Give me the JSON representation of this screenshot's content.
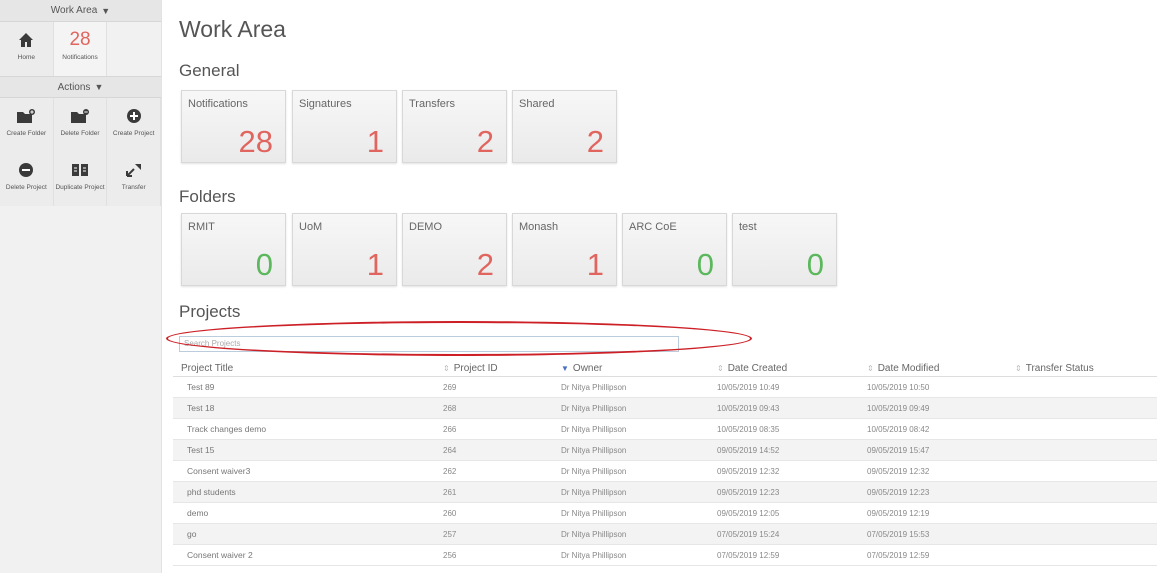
{
  "sidebar": {
    "work_area_label": "Work Area",
    "actions_label": "Actions",
    "home_label": "Home",
    "notifications_count": "28",
    "notifications_label": "Notifications",
    "create_folder_label": "Create Folder",
    "delete_folder_label": "Delete Folder",
    "create_project_label": "Create Project",
    "delete_project_label": "Delete Project",
    "duplicate_project_label": "Duplicate Project",
    "transfer_label": "Transfer"
  },
  "main": {
    "title": "Work Area",
    "general_title": "General",
    "folders_title": "Folders",
    "projects_title": "Projects",
    "general_cards": [
      {
        "label": "Notifications",
        "value": "28"
      },
      {
        "label": "Signatures",
        "value": "1"
      },
      {
        "label": "Transfers",
        "value": "2"
      },
      {
        "label": "Shared",
        "value": "2"
      }
    ],
    "folder_cards": [
      {
        "label": "RMIT",
        "value": "0"
      },
      {
        "label": "UoM",
        "value": "1"
      },
      {
        "label": "DEMO",
        "value": "2"
      },
      {
        "label": "Monash",
        "value": "1"
      },
      {
        "label": "ARC CoE",
        "value": "0"
      },
      {
        "label": "test",
        "value": "0"
      }
    ],
    "search_placeholder": "Search Projects"
  },
  "table": {
    "headers": [
      "Project Title",
      "Project ID",
      "Owner",
      "Date Created",
      "Date Modified",
      "Transfer Status"
    ],
    "rows": [
      [
        "Test 89",
        "269",
        "Dr Nitya Phillipson",
        "10/05/2019 10:49",
        "10/05/2019 10:50",
        ""
      ],
      [
        "Test 18",
        "268",
        "Dr Nitya Phillipson",
        "10/05/2019 09:43",
        "10/05/2019 09:49",
        ""
      ],
      [
        "Track changes demo",
        "266",
        "Dr Nitya Phillipson",
        "10/05/2019 08:35",
        "10/05/2019 08:42",
        ""
      ],
      [
        "Test 15",
        "264",
        "Dr Nitya Phillipson",
        "09/05/2019 14:52",
        "09/05/2019 15:47",
        ""
      ],
      [
        "Consent waiver3",
        "262",
        "Dr Nitya Phillipson",
        "09/05/2019 12:32",
        "09/05/2019 12:32",
        ""
      ],
      [
        "phd students",
        "261",
        "Dr Nitya Phillipson",
        "09/05/2019 12:23",
        "09/05/2019 12:23",
        ""
      ],
      [
        "demo",
        "260",
        "Dr Nitya Phillipson",
        "09/05/2019 12:05",
        "09/05/2019 12:19",
        ""
      ],
      [
        "go",
        "257",
        "Dr Nitya Phillipson",
        "07/05/2019 15:24",
        "07/05/2019 15:53",
        ""
      ],
      [
        "Consent waiver 2",
        "256",
        "Dr Nitya Phillipson",
        "07/05/2019 12:59",
        "07/05/2019 12:59",
        ""
      ]
    ]
  },
  "colors": {
    "count_red": "#e0655f",
    "count_green": "#5cb85c",
    "highlight_oval": "#cc2026"
  }
}
